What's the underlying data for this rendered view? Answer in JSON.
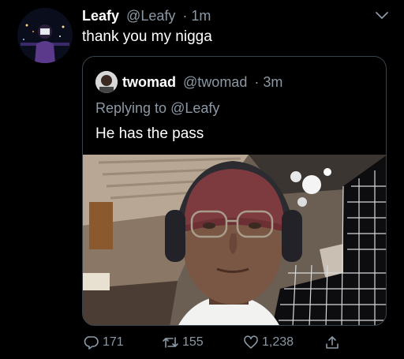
{
  "tweet": {
    "display_name": "Leafy",
    "handle": "@Leafy",
    "time": "· 1m",
    "text": "thank you my nigga"
  },
  "quoted": {
    "display_name": "twomad",
    "handle": "@twomad",
    "time": "· 3m",
    "replying_prefix": "Replying to",
    "replying_to": "@Leafy",
    "text": "He has the pass"
  },
  "actions": {
    "replies": "171",
    "retweets": "155",
    "likes": "1,238"
  },
  "icons": [
    "chevron-down-icon",
    "reply-icon",
    "retweet-icon",
    "like-icon",
    "share-icon"
  ],
  "colors": {
    "background": "#000000",
    "text": "#ffffff",
    "secondary": "#8b98a5",
    "border": "#38444d"
  }
}
